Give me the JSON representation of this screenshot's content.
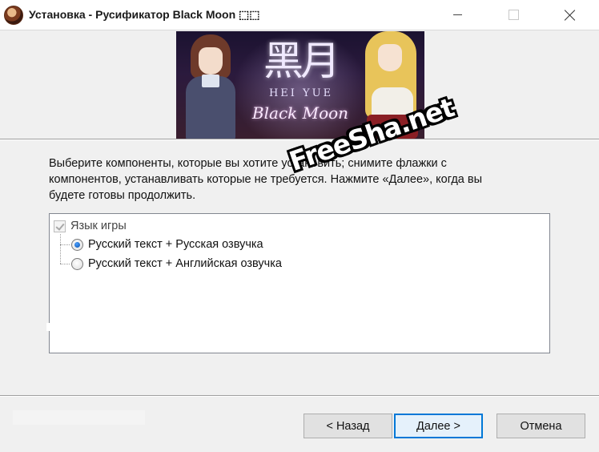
{
  "window": {
    "title": "Установка - Русификатор Black Moon ⬚⬚"
  },
  "banner": {
    "kanji": "黑月",
    "subtitle": "HEI YUE",
    "title": "Black Moon"
  },
  "instructions": {
    "line1": "Выберите компоненты, которые вы хотите установить; снимите флажки с",
    "line2": "компонентов, устанавливать которые не требуется. Нажмите «Далее», когда вы",
    "line3": "будете готовы продолжить."
  },
  "components": {
    "group_label": "Язык игры",
    "group_checked": true,
    "options": [
      {
        "label": "Русский текст + Русская озвучка",
        "selected": true
      },
      {
        "label": "Русский текст + Английская озвучка",
        "selected": false
      }
    ]
  },
  "buttons": {
    "back": "< Назад",
    "next": "Далее >",
    "cancel": "Отмена"
  },
  "watermark": "FreeSha.net",
  "colors": {
    "focus_border": "#0078d7",
    "dialog_bg": "#f0f0f0"
  }
}
